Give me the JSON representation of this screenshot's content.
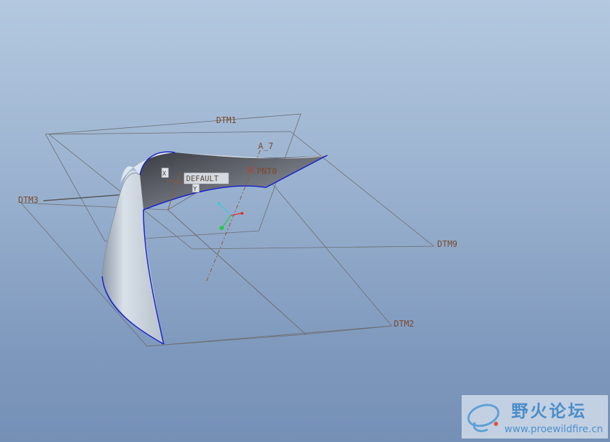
{
  "datums": {
    "dtm1": "DTM1",
    "dtm2": "DTM2",
    "dtm3": "DTM3",
    "dtm9": "DTM9",
    "axis": "A_7",
    "point": "PNT0",
    "csys": "DEFAULT"
  },
  "watermark": {
    "title": "野火论坛",
    "url": "www.proewildfire.cn"
  },
  "colors": {
    "background_top": "#b4c9e0",
    "background_bottom": "#7590b6",
    "surface_edge": "#1a22cc",
    "datum_label": "#7a4a2a",
    "csys_x": "#e03030",
    "csys_y": "#22cc44",
    "csys_z": "#33ccdd"
  }
}
